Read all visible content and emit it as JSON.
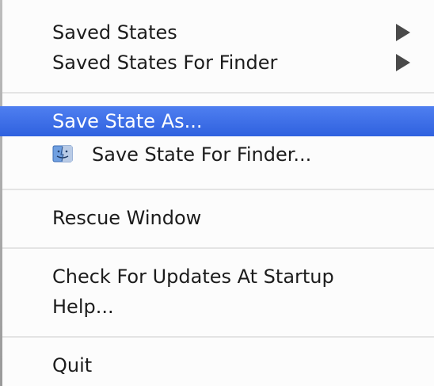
{
  "menu": {
    "saved_states": "Saved States",
    "saved_states_finder": "Saved States For Finder",
    "save_state_as": "Save State As...",
    "save_state_finder": "Save State For Finder...",
    "rescue_window": "Rescue Window",
    "check_updates": "Check For Updates At Startup",
    "help": "Help...",
    "quit": "Quit"
  },
  "icons": {
    "submenu": "submenu-arrow-icon",
    "finder": "finder-icon"
  },
  "colors": {
    "selection": "#3467e6",
    "text": "#1c1c1c",
    "selected_text": "#ffffff"
  }
}
